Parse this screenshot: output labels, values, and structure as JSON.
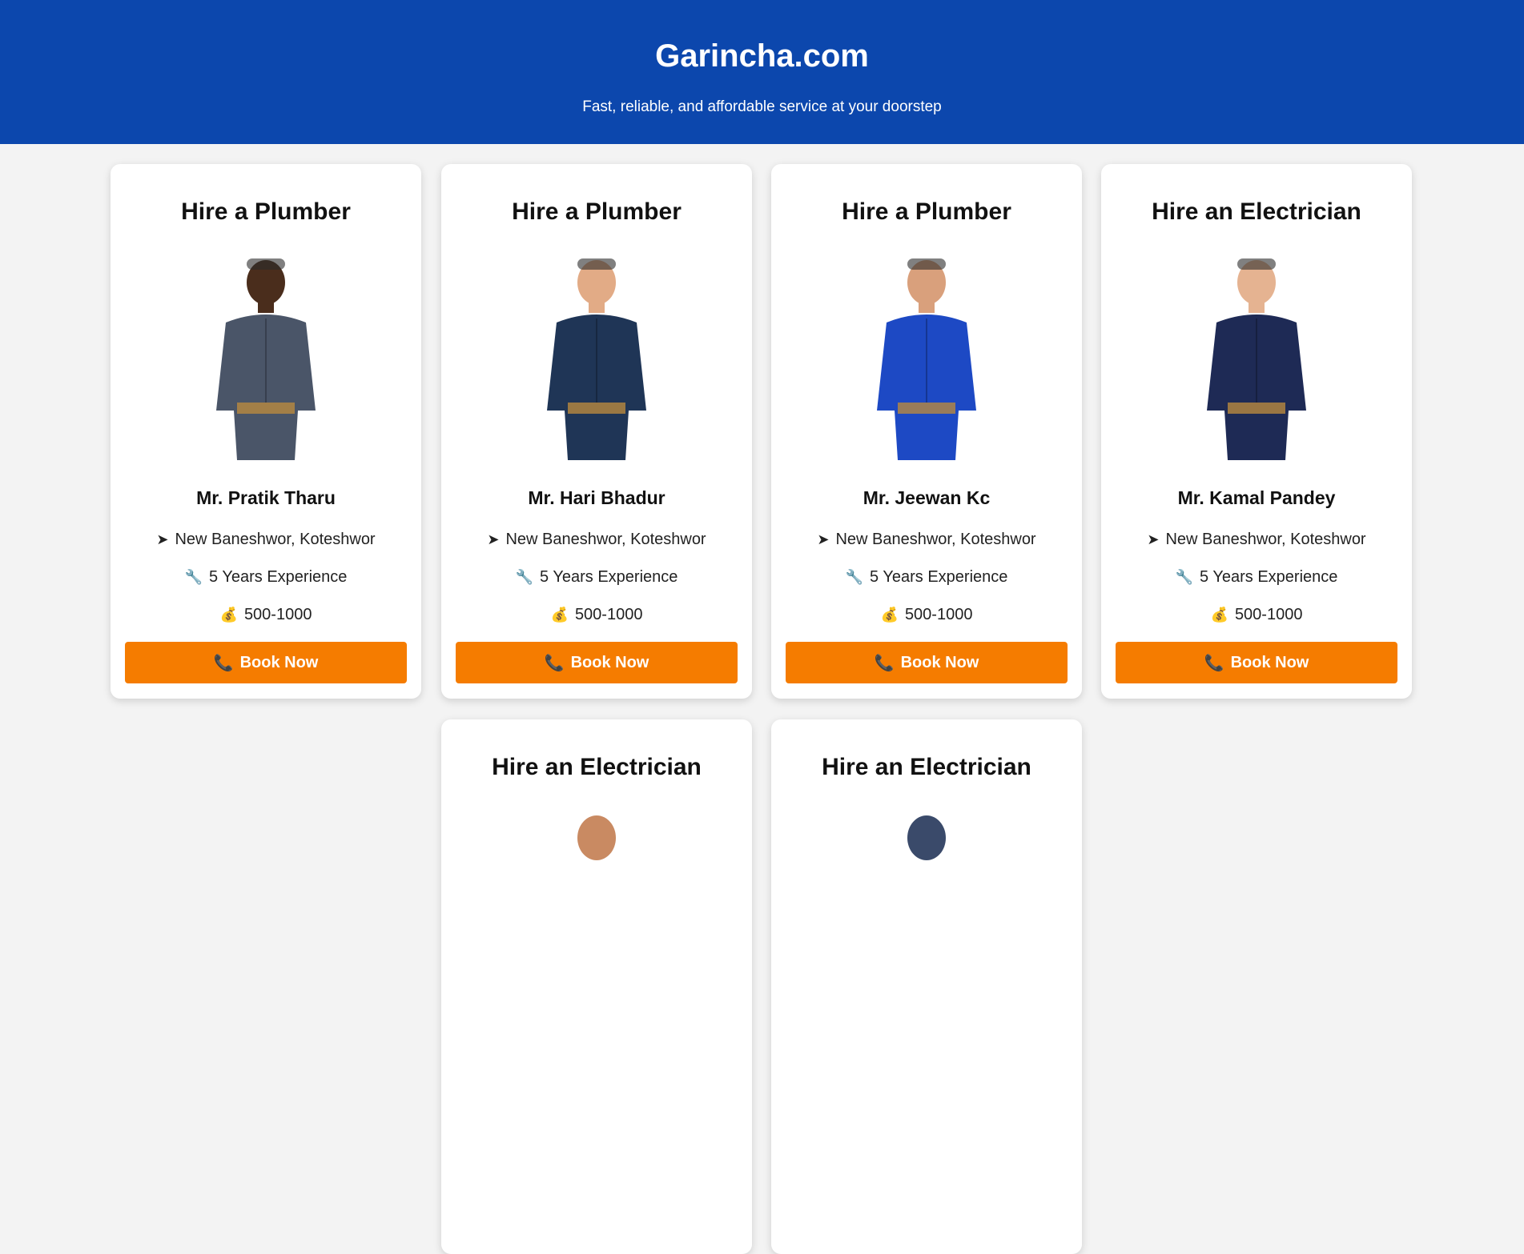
{
  "header": {
    "title": "Garincha.com",
    "tagline": "Fast, reliable, and affordable service at your doorstep"
  },
  "cards": [
    {
      "title": "Hire a Plumber",
      "name": "Mr. Pratik Tharu",
      "location": "New Baneshwor, Koteshwor",
      "experience": "5 Years Experience",
      "price": "500-1000",
      "button": "Book Now",
      "outfit": "#4a5568",
      "skin": "#4a2d1c"
    },
    {
      "title": "Hire a Plumber",
      "name": "Mr. Hari Bhadur",
      "location": "New Baneshwor, Koteshwor",
      "experience": "5 Years Experience",
      "price": "500-1000",
      "button": "Book Now",
      "outfit": "#1f3556",
      "skin": "#e2ab86"
    },
    {
      "title": "Hire a Plumber",
      "name": "Mr. Jeewan Kc",
      "location": "New Baneshwor, Koteshwor",
      "experience": "5 Years Experience",
      "price": "500-1000",
      "button": "Book Now",
      "outfit": "#1d49c4",
      "skin": "#d9a07c"
    },
    {
      "title": "Hire an Electrician",
      "name": "Mr. Kamal Pandey",
      "location": "New Baneshwor, Koteshwor",
      "experience": "5 Years Experience",
      "price": "500-1000",
      "button": "Book Now",
      "outfit": "#1e2a55",
      "skin": "#e5b391"
    },
    {
      "title": "Hire an Electrician"
    },
    {
      "title": "Hire an Electrician"
    }
  ],
  "icons": {
    "location": "arrow-icon",
    "experience": "wrench-icon",
    "price": "money-bag-icon",
    "button": "phone-icon"
  },
  "colors": {
    "header_bg": "#0c47ad",
    "button_bg": "#f57c00",
    "page_bg": "#f3f3f3"
  }
}
